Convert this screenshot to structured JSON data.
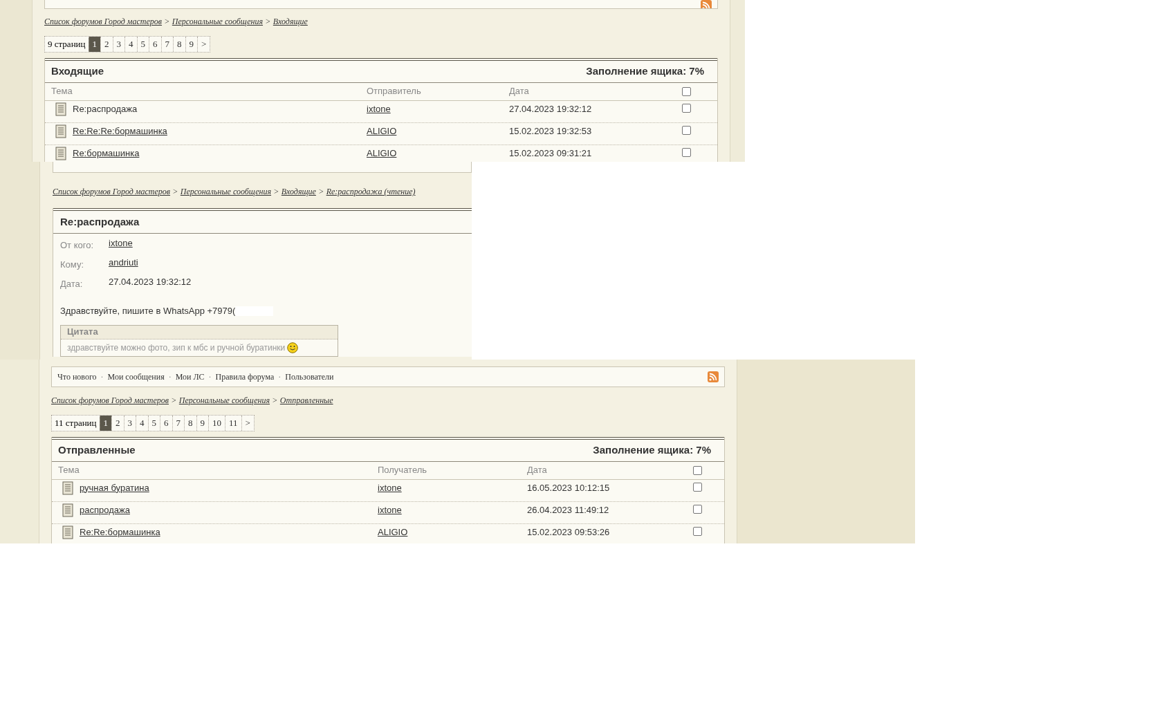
{
  "separator": ">",
  "menu_separator": "·",
  "inbox_view": {
    "breadcrumbs": [
      "Список форумов Город мастеров",
      "Персональные сообщения",
      "Входящие"
    ],
    "pages_label": "9 страниц",
    "pages": [
      {
        "label": "1",
        "selected": true
      },
      {
        "label": "2",
        "selected": false
      },
      {
        "label": "3",
        "selected": false
      },
      {
        "label": "4",
        "selected": false
      },
      {
        "label": "5",
        "selected": false
      },
      {
        "label": "6",
        "selected": false
      },
      {
        "label": "7",
        "selected": false
      },
      {
        "label": "8",
        "selected": false
      },
      {
        "label": "9",
        "selected": false
      },
      {
        "label": ">",
        "selected": false
      }
    ],
    "title": "Входящие",
    "fill": "Заполнение ящика: 7%",
    "columns": [
      "Тема",
      "Отправитель",
      "Дата"
    ],
    "all_checked": false,
    "rows": [
      {
        "subject": "Re:распродажа",
        "link": false,
        "person": "ixtone",
        "date": "27.04.2023 19:32:12",
        "checked": false
      },
      {
        "subject": "Re:Re:Re:бормашинка",
        "link": true,
        "person": "ALIGIO",
        "date": "15.02.2023 19:32:53",
        "checked": false
      },
      {
        "subject": "Re:бормашинка",
        "link": true,
        "person": "ALIGIO",
        "date": "15.02.2023 09:31:21",
        "checked": false
      }
    ]
  },
  "message_view": {
    "breadcrumbs": [
      "Список форумов Город мастеров",
      "Персональные сообщения",
      "Входящие",
      "Re:распродажа (чтение)"
    ],
    "title": "Re:распродажа",
    "fields": [
      {
        "label": "От кого:",
        "value": "ixtone",
        "link": true
      },
      {
        "label": "Кому:",
        "value": "andriuti",
        "link": true
      },
      {
        "label": "Дата:",
        "value": "27.04.2023 19:32:12",
        "link": false
      }
    ],
    "body": "Здравствуйте, пишите в WhatsApp +7979(",
    "quote": {
      "title": "Цитата",
      "text": "здравствуйте можно фото, зип к мбс и ручной буратинки"
    }
  },
  "sent_view": {
    "menu": [
      "Что нового",
      "Мои сообщения",
      "Мои ЛС",
      "Правила форума",
      "Пользователи"
    ],
    "breadcrumbs": [
      "Список форумов Город мастеров",
      "Персональные сообщения",
      "Отправленные"
    ],
    "pages_label": "11 страниц",
    "pages": [
      {
        "label": "1",
        "selected": true
      },
      {
        "label": "2",
        "selected": false
      },
      {
        "label": "3",
        "selected": false
      },
      {
        "label": "4",
        "selected": false
      },
      {
        "label": "5",
        "selected": false
      },
      {
        "label": "6",
        "selected": false
      },
      {
        "label": "7",
        "selected": false
      },
      {
        "label": "8",
        "selected": false
      },
      {
        "label": "9",
        "selected": false
      },
      {
        "label": "10",
        "selected": false
      },
      {
        "label": "11",
        "selected": false
      },
      {
        "label": ">",
        "selected": false
      }
    ],
    "title": "Отправленные",
    "fill": "Заполнение ящика: 7%",
    "columns": [
      "Тема",
      "Получатель",
      "Дата"
    ],
    "all_checked": false,
    "rows": [
      {
        "subject": "ручная буратина",
        "link": true,
        "person": "ixtone",
        "date": "16.05.2023 10:12:15",
        "checked": false
      },
      {
        "subject": "распродажа",
        "link": true,
        "person": "ixtone",
        "date": "26.04.2023 11:49:12",
        "checked": false
      },
      {
        "subject": "Re:Re:бормашинка",
        "link": true,
        "person": "ALIGIO",
        "date": "15.02.2023 09:53:26",
        "checked": false
      }
    ]
  }
}
